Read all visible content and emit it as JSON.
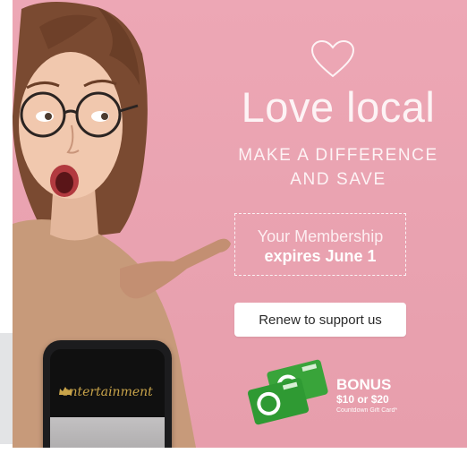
{
  "hero": {
    "title": "Love local",
    "subtitle": "MAKE A DIFFERENCE\nAND SAVE"
  },
  "membership": {
    "line1": "Your Membership",
    "line2": "expires June 1"
  },
  "cta": {
    "label": "Renew to support us"
  },
  "bonus": {
    "title": "BONUS",
    "amount": "$10 or $20",
    "subtitle": "Countdown Gift Card*"
  },
  "phone": {
    "logo": "entertainment"
  },
  "icons": {
    "heart": "heart-outline-icon",
    "crown": "crown-icon",
    "gift_cards": "countdown-gift-card-icon"
  },
  "colors": {
    "background_pink": "#eda7b5",
    "text_light": "#fdf3f5",
    "button_bg": "#ffffff",
    "brand_green": "#3aa53a",
    "logo_gold": "#c9a44a"
  }
}
